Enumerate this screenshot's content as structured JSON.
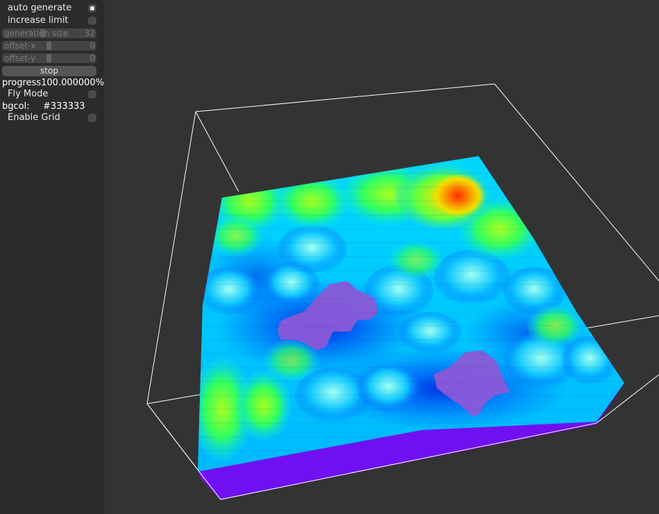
{
  "panel": {
    "auto_generate": {
      "label": "auto generate",
      "checked": true
    },
    "increase_limit": {
      "label": "increase limit",
      "checked": false
    },
    "generation_size": {
      "label": "generation size",
      "value": "32",
      "fraction": 0.45
    },
    "offset_x": {
      "label": "offset-x",
      "value": "0",
      "fraction": 0.5
    },
    "offset_y": {
      "label": "offset-y",
      "value": "0",
      "fraction": 0.5
    },
    "stop_button": "stop",
    "progress": {
      "label": "progress",
      "value": "100.000000%"
    },
    "fly_mode": {
      "label": "Fly Mode",
      "checked": false
    },
    "bgcol": {
      "label": "bgcol:",
      "value": "#333333"
    },
    "enable_grid": {
      "label": "Enable Grid",
      "checked": false
    }
  },
  "scene": {
    "background_color": "#333333",
    "bounding_box_color": "#ffffff",
    "colormap": [
      "#6a00d8",
      "#0040ff",
      "#00c8ff",
      "#00ff80",
      "#ffff00",
      "#ff2000"
    ]
  }
}
